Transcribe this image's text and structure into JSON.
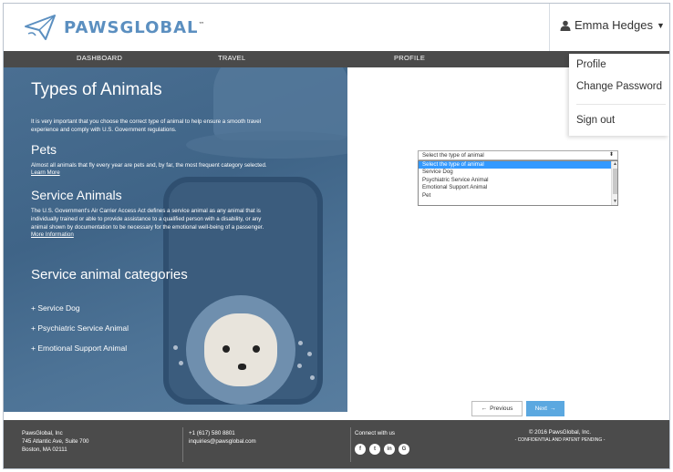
{
  "header": {
    "logo_text": "PAWSGLOBAL",
    "logo_tm": "™",
    "user_name": "Emma Hedges"
  },
  "nav": {
    "items": [
      "DASHBOARD",
      "TRAVEL",
      "PROFILE"
    ]
  },
  "user_dropdown": {
    "items": [
      "Profile",
      "Change Password",
      "Sign out"
    ]
  },
  "hero": {
    "title": "Types of Animals",
    "intro_line1": "It is very important that you choose the correct type of animal to help ensure a smooth travel",
    "intro_line2": "experience and comply with U.S. Government regulations.",
    "pets_heading": "Pets",
    "pets_text": "Almost all animals that fly every year are pets and, by far, the most frequent category selected.",
    "pets_link": "Learn More",
    "service_heading": "Service Animals",
    "service_line1": "The U.S. Government's Air Carrier Access Act defines a service animal as any animal that is",
    "service_line2": "individually trained or able to provide assistance to a qualified person with a disability, or any",
    "service_line3": "animal shown by documentation to be necessary for the emotional well-being of a passenger.",
    "service_link": "More Information",
    "categories_heading": "Service animal categories",
    "categories": [
      "+ Service Dog",
      "+ Psychiatric Service Animal",
      "+ Emotional Support Animal"
    ]
  },
  "animal_select": {
    "value": "Select the type of animal",
    "options": [
      "Select the type of animal",
      "Service Dog",
      "Psychiatric Service Animal",
      "Emotional Support Animal",
      "Pet"
    ],
    "selected_index": 0
  },
  "pager": {
    "previous_label": "Previous",
    "next_label": "Next"
  },
  "footer": {
    "company": "PawsGlobal, Inc",
    "address1": "745 Atlantic Ave, Suite 700",
    "address2": "Boston, MA 02111",
    "phone": "+1 (617) 580 8801",
    "email": "inquiries@pawsglobal.com",
    "connect": "Connect with us",
    "social": [
      "f",
      "t",
      "in",
      "G"
    ],
    "copyright": "© 2016 PawsGlobal, Inc.",
    "confidential": "- CONFIDENTIAL AND PATENT PENDING -"
  },
  "colors": {
    "nav_bg": "#4a4a4a",
    "footer_bg": "#4b4b4b",
    "hero_tint": "#4a6f92",
    "next_button": "#5ba8e0",
    "select_highlight": "#3399ff"
  }
}
